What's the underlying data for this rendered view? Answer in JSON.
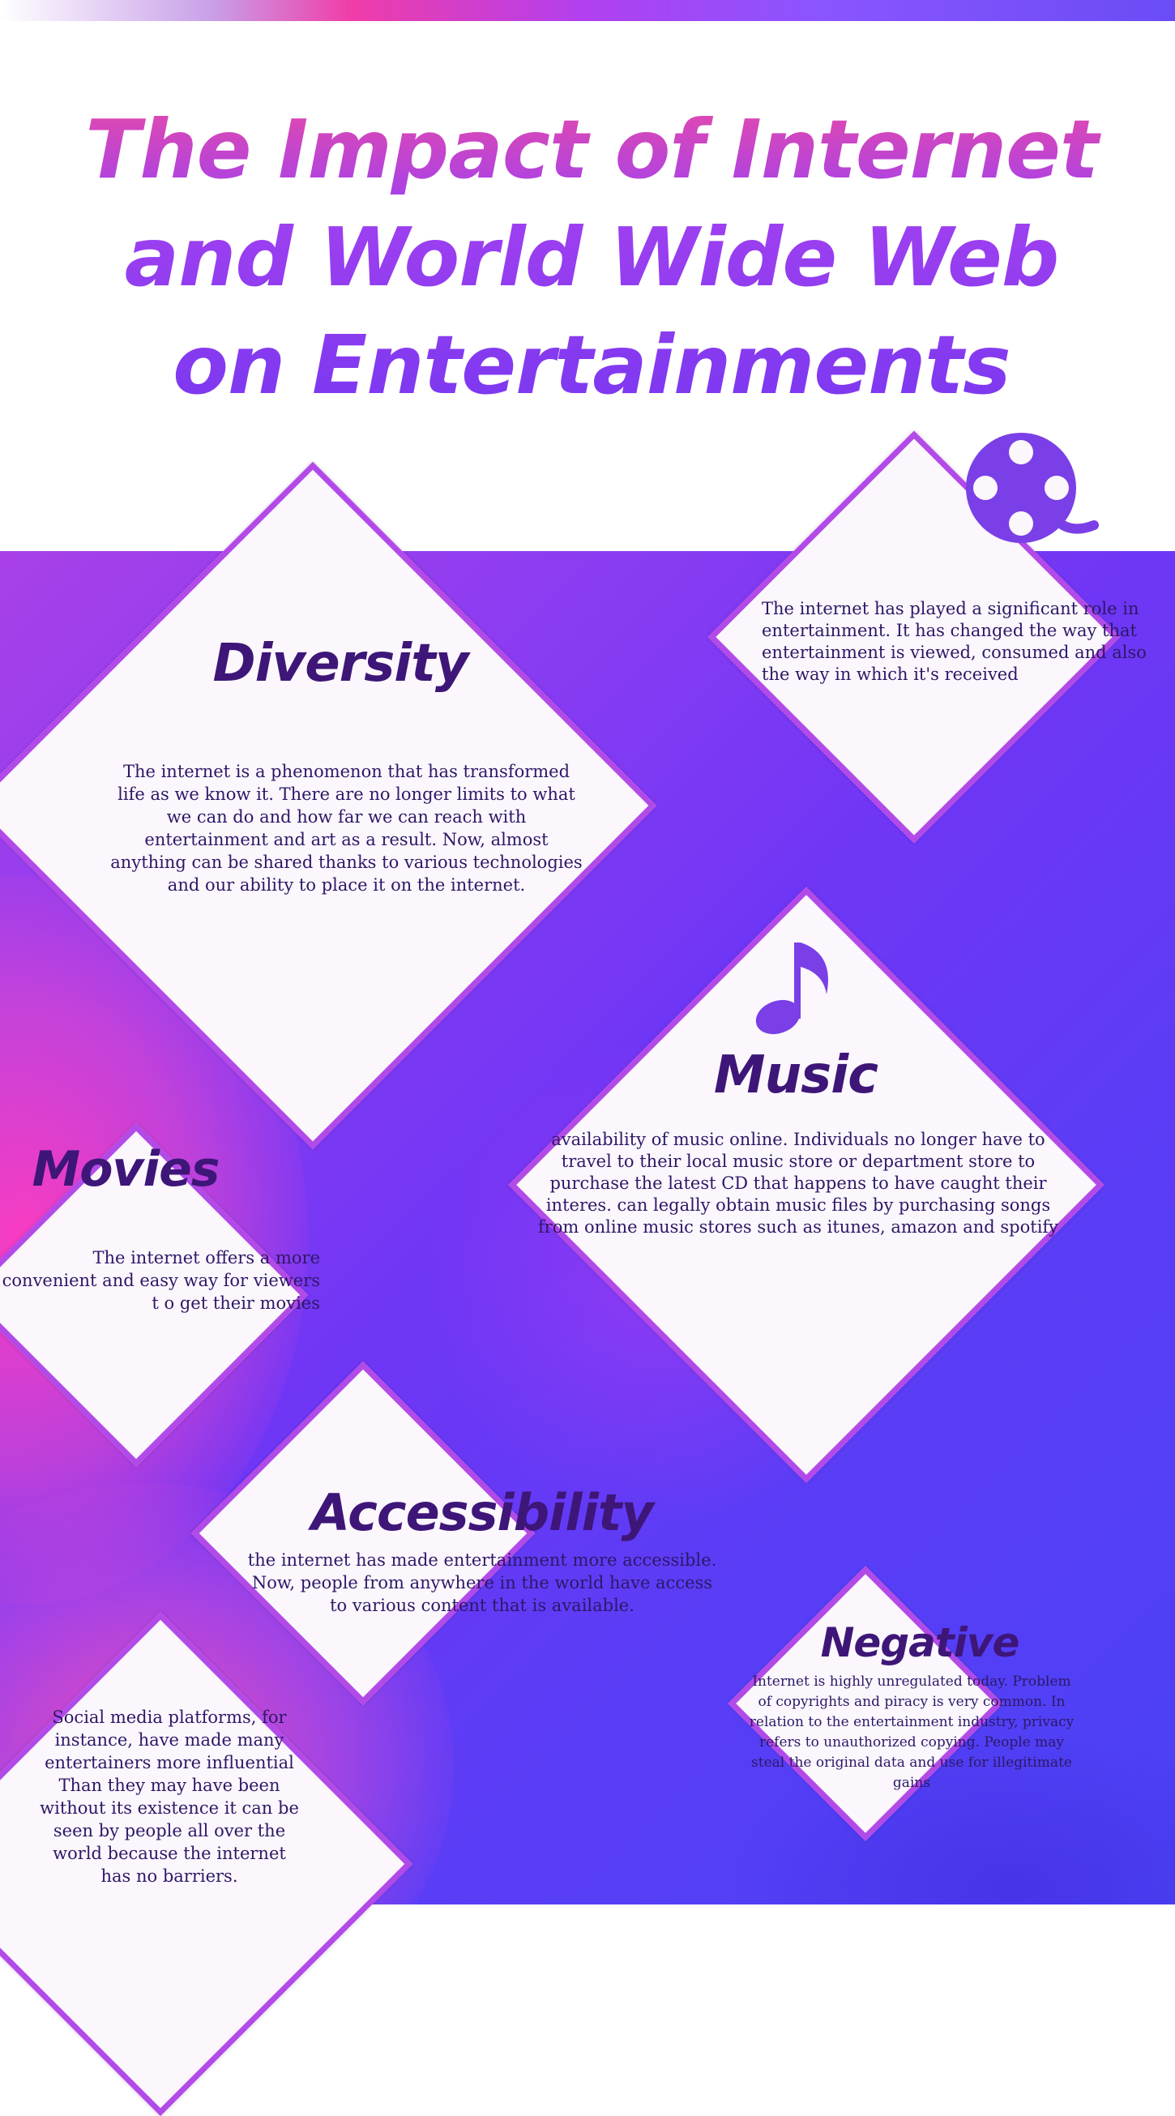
{
  "title": "The Impact of Internet and World Wide Web on Entertainments",
  "intro": {
    "text": "The internet has played a significant role in entertainment. It has changed the way that entertainment is viewed, consumed and also the way in which it's received",
    "icon": "film-reel-icon"
  },
  "diversity": {
    "heading": "Diversity",
    "text": "The internet is a phenomenon that has transformed life as we know it. There are no longer limits to what we can do and how far we can reach with entertainment and art as a result. Now, almost anything can be shared thanks to various technologies and our ability to place it on the internet."
  },
  "music": {
    "heading": "Music",
    "icon": "music-note-icon",
    "text": "availability of music online. Individuals no longer have to travel to their local music store or department store to purchase the latest CD that happens to have caught their interes. can legally obtain music files by purchasing songs from online music stores such as itunes, amazon and spotify"
  },
  "movies": {
    "heading": "Movies",
    "text": "The internet offers a more convenient and easy way for viewers t o get their movies"
  },
  "accessibility": {
    "heading": "Accessibility",
    "text": "the internet has made entertainment more accessible. Now, people from anywhere in the world have access to various content that is available."
  },
  "social": {
    "text": "Social media platforms, for instance, have made many entertainers more influential Than they may have been without its existence it can be seen by people all over the world because the internet has no barriers."
  },
  "negative": {
    "heading": "Negative",
    "text": "Internet is highly unregulated today. Problem of copyrights and piracy is very common. In relation to the entertainment industry, privacy refers to unauthorized copying. People may steal the original data and use for illegitimate gains"
  },
  "colors": {
    "accent": "#b24ae8",
    "heading": "#3e1678",
    "icon": "#7a3fe6",
    "background_from": "#a840e8",
    "background_to": "#4a42f5"
  }
}
